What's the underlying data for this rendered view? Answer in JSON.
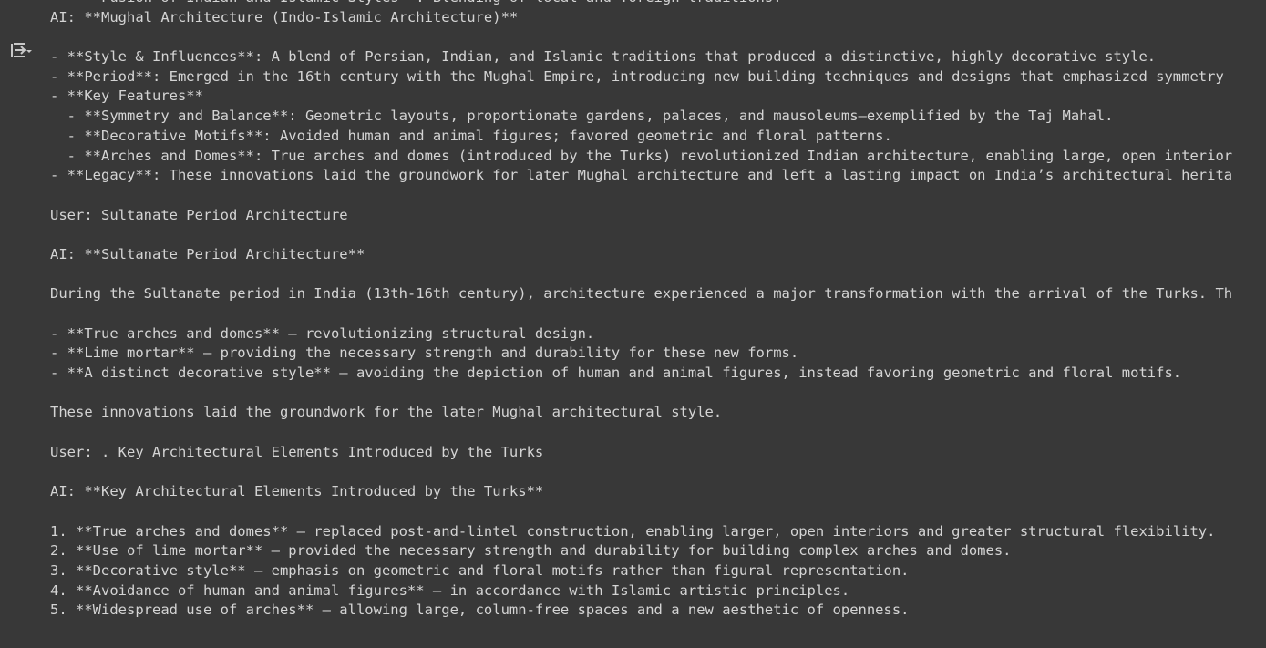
{
  "output": {
    "toggle_icon": "output-collapse-icon",
    "lines": [
      "  - **Fusion of Indian and Islamic Styles**: Blending of local and foreign traditions.",
      "AI: **Mughal Architecture (Indo-Islamic Architecture)**",
      "",
      "- **Style & Influences**: A blend of Persian, Indian, and Islamic traditions that produced a distinctive, highly decorative style.",
      "- **Period**: Emerged in the 16th century with the Mughal Empire, introducing new building techniques and designs that emphasized symmetry",
      "- **Key Features**",
      "  - **Symmetry and Balance**: Geometric layouts, proportionate gardens, palaces, and mausoleums—exemplified by the Taj Mahal.",
      "  - **Decorative Motifs**: Avoided human and animal figures; favored geometric and floral patterns.",
      "  - **Arches and Domes**: True arches and domes (introduced by the Turks) revolutionized Indian architecture, enabling large, open interior",
      "- **Legacy**: These innovations laid the groundwork for later Mughal architecture and left a lasting impact on India’s architectural herita",
      "",
      "User: Sultanate Period Architecture",
      "",
      "AI: **Sultanate Period Architecture**",
      "",
      "During the Sultanate period in India (13th-16th century), architecture experienced a major transformation with the arrival of the Turks. Th",
      "",
      "- **True arches and domes** – revolutionizing structural design.",
      "- **Lime mortar** – providing the necessary strength and durability for these new forms.",
      "- **A distinct decorative style** – avoiding the depiction of human and animal figures, instead favoring geometric and floral motifs.",
      "",
      "These innovations laid the groundwork for the later Mughal architectural style.",
      "",
      "User: . Key Architectural Elements Introduced by the Turks",
      "",
      "AI: **Key Architectural Elements Introduced by the Turks**",
      "",
      "1. **True arches and domes** – replaced post-and-lintel construction, enabling larger, open interiors and greater structural flexibility.",
      "2. **Use of lime mortar** – provided the necessary strength and durability for building complex arches and domes.",
      "3. **Decorative style** – emphasis on geometric and floral motifs rather than figural representation.",
      "4. **Avoidance of human and animal figures** – in accordance with Islamic artistic principles.",
      "5. **Widespread use of arches** – allowing large, column-free spaces and a new aesthetic of openness."
    ]
  },
  "colors": {
    "background": "#383838",
    "text": "#d4d4d4",
    "icon": "#c8c8c8"
  }
}
